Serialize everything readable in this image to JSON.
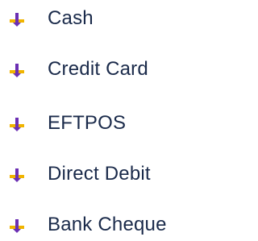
{
  "payment_methods": {
    "bullet_icon": "down-arrow-icon",
    "bullet_colors": {
      "shaft": "#6b2fb3",
      "wings": "#f0b400"
    },
    "text_color": "#1a2a4a",
    "items": [
      {
        "label": "Cash"
      },
      {
        "label": "Credit Card"
      },
      {
        "label": "EFTPOS"
      },
      {
        "label": "Direct Debit"
      },
      {
        "label": "Bank Cheque"
      }
    ]
  }
}
